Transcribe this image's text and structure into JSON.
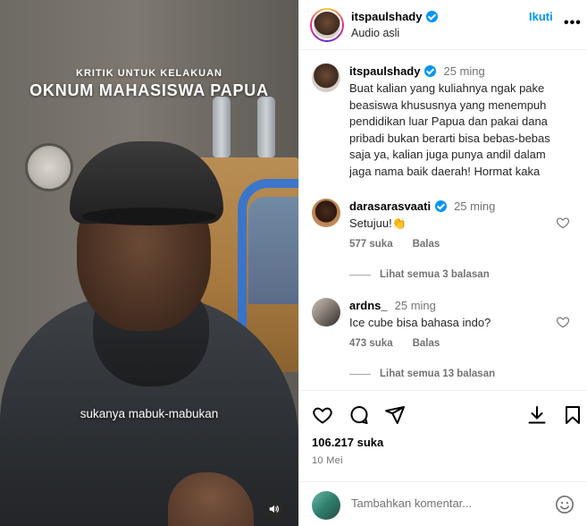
{
  "video": {
    "overlay_small": "KRITIK UNTUK KELAKUAN",
    "overlay_big": "OKNUM MAHASISWA PAPUA",
    "caption": "sukanya mabuk-mabukan",
    "mute_icon": "speaker-icon"
  },
  "header": {
    "username": "itspaulshady",
    "verified": true,
    "subtitle": "Audio asli",
    "follow_label": "Ikuti",
    "more_label": "•••"
  },
  "caption_comment": {
    "username": "itspaulshady",
    "time": "25 ming",
    "lines": [
      "Buat kalian yang kuliahnya ngak pake",
      "beasiswa khususnya yang menempuh",
      "pendidikan luar Papua dan pakai dana",
      "pribadi bukan berarti bisa bebas-bebas",
      "saja ya, kalian juga punya andil dalam",
      "jaga nama baik daerah! Hormat kaka"
    ]
  },
  "comments": [
    {
      "username": "darasarasvaati",
      "verified": true,
      "time": "25 ming",
      "text": "Setujuu!👏",
      "likes": "577 suka",
      "reply_label": "Balas",
      "view_replies": "Lihat semua 3 balasan"
    },
    {
      "username": "ardns_",
      "verified": false,
      "time": "25 ming",
      "text": "Ice cube bisa bahasa indo?",
      "likes": "473 suka",
      "reply_label": "Balas",
      "view_replies": "Lihat semua 13 balasan"
    }
  ],
  "actions": {
    "likes": "106.217 suka",
    "date": "10 Mei"
  },
  "add_comment": {
    "placeholder": "Tambahkan komentar..."
  },
  "colors": {
    "accent": "#0095f6",
    "muted": "#737373",
    "border": "#efefef"
  }
}
